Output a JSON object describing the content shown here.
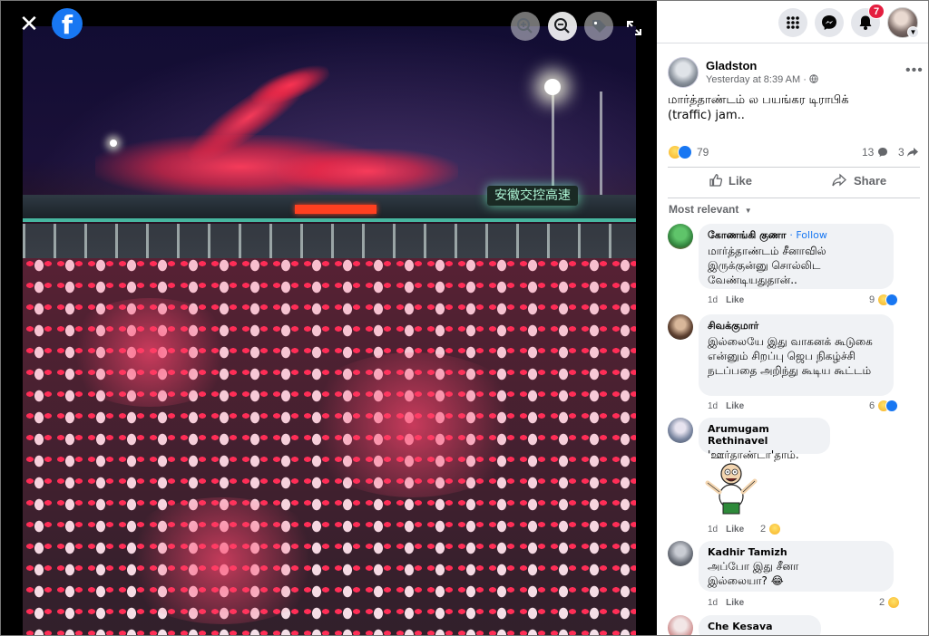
{
  "viewer": {
    "close_icon": "close-icon",
    "logo_icon": "facebook-logo-icon",
    "logo_letter": "f",
    "controls": [
      "zoom-in-icon",
      "zoom-out-icon",
      "tag-icon",
      "fullscreen-icon"
    ],
    "sign_text": "安徽交控高速"
  },
  "topbar": {
    "icons": [
      "menu-grid-icon",
      "messenger-icon",
      "bell-icon"
    ],
    "notification_count": "7"
  },
  "post": {
    "author": "Gladston",
    "time": "Yesterday at 8:39 AM · ",
    "privacy_icon": "globe-icon",
    "text": "மார்த்தாண்டம் ல பயங்கர டிராபிக் (traffic) jam..",
    "reaction_count": "79",
    "comment_count": "13",
    "share_count": "3",
    "like_label": "Like",
    "share_label": "Share",
    "sort_label": "Most relevant"
  },
  "comments": [
    {
      "name": "கோணங்கி குணா",
      "follow": "Follow",
      "text": "மார்த்தாண்டம் சீனாவில் இருக்குன்னு சொல்லிட வேண்டியதுதான்..",
      "time": "1d",
      "like": "Like",
      "reactions": "9"
    },
    {
      "name": "சிவக்குமார்",
      "text": "இல்லையே இது வாகனக் கூடுகை என்னும் சிறப்பு ஜெப நிகழ்ச்சி நடப்பதை அறிந்து கூடிய கூட்டம்",
      "time": "1d",
      "like": "Like",
      "reactions": "6"
    },
    {
      "name": "Arumugam Rethinavel",
      "text": "'ஊர்தாண்டா'தாம்.",
      "time": "1d",
      "like": "Like",
      "reactions": "2"
    },
    {
      "name": "Kadhir Tamizh",
      "text": "அப்போ இது சீனா இல்லையா? 😂",
      "time": "1d",
      "like": "Like",
      "reactions": "2"
    },
    {
      "name": "Che Kesava"
    }
  ],
  "colors": {
    "brand": "#1877f2",
    "badge": "#e41e3f",
    "bubble": "#f0f2f5",
    "muted": "#65676b"
  }
}
